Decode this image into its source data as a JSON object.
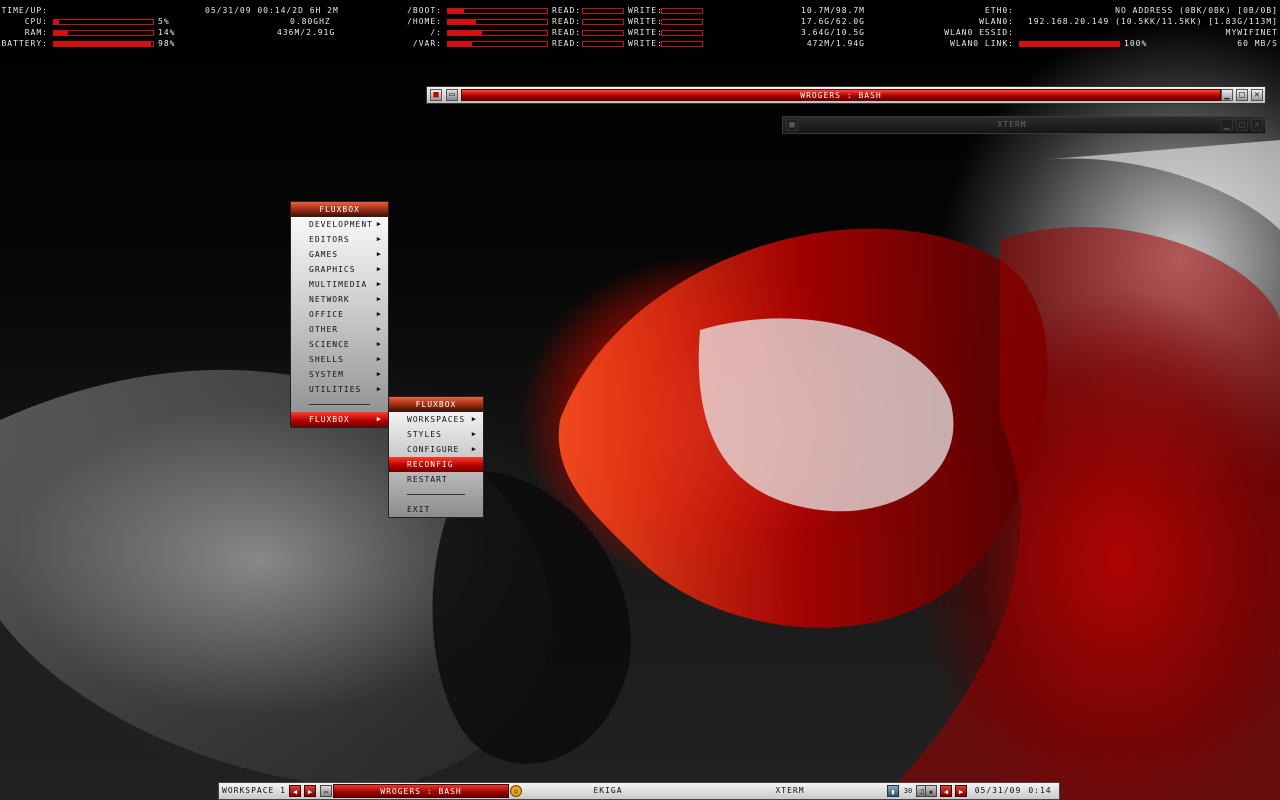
{
  "conky": {
    "system": [
      {
        "label": "TIME/UP:",
        "value": "05/31/09 00:14/2D 6H 2M",
        "bar": null
      },
      {
        "label": "CPU:",
        "value": "5%",
        "extra": "0.80GHZ",
        "bar": 0.05
      },
      {
        "label": "RAM:",
        "value": "14%",
        "extra": "436M/2.91G",
        "bar": 0.14
      },
      {
        "label": "BATTERY:",
        "value": "98%",
        "extra": "",
        "bar": 0.98
      }
    ],
    "disks": [
      {
        "label": "/BOOT:",
        "bar": 0.16,
        "read_label": "READ:",
        "write_label": "WRITE:",
        "usage": "10.7M/98.7M"
      },
      {
        "label": "/HOME:",
        "bar": 0.28,
        "read_label": "READ:",
        "write_label": "WRITE:",
        "usage": "17.6G/62.0G"
      },
      {
        "label": "/:",
        "bar": 0.34,
        "read_label": "READ:",
        "write_label": "WRITE:",
        "usage": "3.64G/10.5G"
      },
      {
        "label": "/VAR:",
        "bar": 0.24,
        "read_label": "READ:",
        "write_label": "WRITE:",
        "usage": "472M/1.94G"
      }
    ],
    "network": [
      {
        "label": "ETH0:",
        "value": "NO ADDRESS (0BK/0BK) [0B/0B]"
      },
      {
        "label": "WLAN0:",
        "value": "192.168.20.149 (10.5KK/11.5KK) [1.83G/113M]"
      },
      {
        "label": "WLAN0 ESSID:",
        "value": "MYWIFINET"
      },
      {
        "label": "WLAN0 LINK:",
        "value": "100%",
        "extra": "60 MB/S",
        "bar": 1.0
      }
    ]
  },
  "windows": {
    "bash": {
      "title": "WROGERS : BASH",
      "active": true
    },
    "xterm": {
      "title": "XTERM",
      "active": false
    }
  },
  "root_menu": {
    "title": "FLUXBOX",
    "items": [
      {
        "label": "DEVELOPMENT",
        "submenu": true
      },
      {
        "label": "EDITORS",
        "submenu": true
      },
      {
        "label": "GAMES",
        "submenu": true
      },
      {
        "label": "GRAPHICS",
        "submenu": true
      },
      {
        "label": "MULTIMEDIA",
        "submenu": true
      },
      {
        "label": "NETWORK",
        "submenu": true
      },
      {
        "label": "OFFICE",
        "submenu": true
      },
      {
        "label": "OTHER",
        "submenu": true
      },
      {
        "label": "SCIENCE",
        "submenu": true
      },
      {
        "label": "SHELLS",
        "submenu": true
      },
      {
        "label": "SYSTEM",
        "submenu": true
      },
      {
        "label": "UTILITIES",
        "submenu": true
      }
    ],
    "footer": {
      "label": "FLUXBOX",
      "submenu": true,
      "highlighted": true
    }
  },
  "fluxbox_menu": {
    "title": "FLUXBOX",
    "items": [
      {
        "label": "WORKSPACES",
        "submenu": true
      },
      {
        "label": "STYLES",
        "submenu": true
      },
      {
        "label": "CONFIGURE",
        "submenu": true
      },
      {
        "label": "RECONFIG",
        "submenu": false,
        "highlighted": true
      },
      {
        "label": "RESTART",
        "submenu": false
      }
    ],
    "exit_label": "EXIT"
  },
  "taskbar": {
    "workspace": "WORKSPACE 1",
    "tasks": [
      {
        "label": "WROGERS : BASH",
        "active": true
      },
      {
        "label": "EKIGA",
        "active": false
      },
      {
        "label": "XTERM",
        "active": false
      }
    ],
    "clock": "05/31/09",
    "time": "0:14",
    "tray_volume": "30"
  },
  "colors": {
    "accent": "#d41010",
    "menu_title": "#b03a20"
  }
}
